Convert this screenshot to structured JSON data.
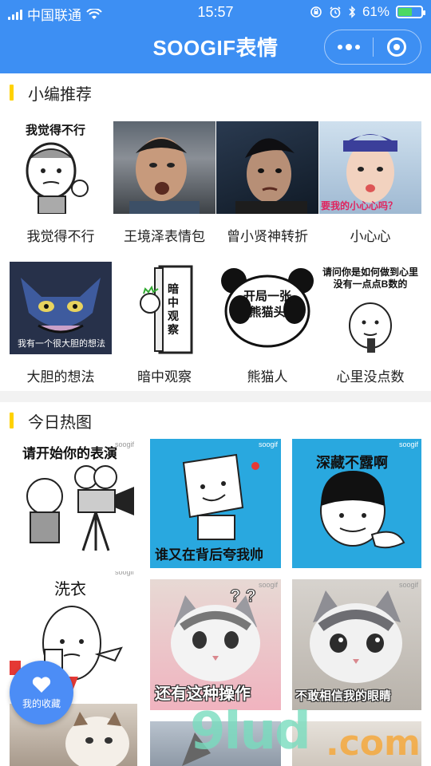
{
  "status_bar": {
    "carrier": "中国联通",
    "time": "15:57",
    "battery_percent": "61%",
    "battery_level": 0.61,
    "battery_color": "#4cd964"
  },
  "nav": {
    "title": "SOOGIF表情",
    "background": "#3d8ff3",
    "more_icon": "more-dots-icon",
    "close_icon": "target-icon"
  },
  "sections": {
    "recommend_title": "小编推荐",
    "hot_title": "今日热图",
    "accent": "#ffd200"
  },
  "recommend": [
    {
      "label": "我觉得不行",
      "image_text": "我觉得不行"
    },
    {
      "label": "王境泽表情包"
    },
    {
      "label": "曾小贤神转折"
    },
    {
      "label": "小心心",
      "image_text": "要我的小心心吗？"
    },
    {
      "label": "大胆的想法",
      "image_text": "我有一个很大胆的想法"
    },
    {
      "label": "暗中观察",
      "image_text": "暗中观察"
    },
    {
      "label": "熊猫人",
      "image_text": "开局一张熊猫头"
    },
    {
      "label": "心里没点数",
      "image_text": "请问你是如何做到心里没有一点点B数的"
    }
  ],
  "hot": [
    {
      "text": "请开始你的表演",
      "watermark": "soogif"
    },
    {
      "text": "谁又在背后夸我帅",
      "watermark": "soogif"
    },
    {
      "text": "深藏不露啊",
      "watermark": "soogif"
    },
    {
      "text": "洗衣",
      "watermark": "soogif"
    },
    {
      "text": "还有这种操作",
      "watermark": "soogif"
    },
    {
      "text": "不敢相信我的眼睛",
      "watermark": "soogif"
    }
  ],
  "fab": {
    "label": "我的收藏",
    "icon": "heart-icon"
  },
  "watermark_brand": {
    "text_main": "9lud",
    "text_tail": ".com"
  }
}
